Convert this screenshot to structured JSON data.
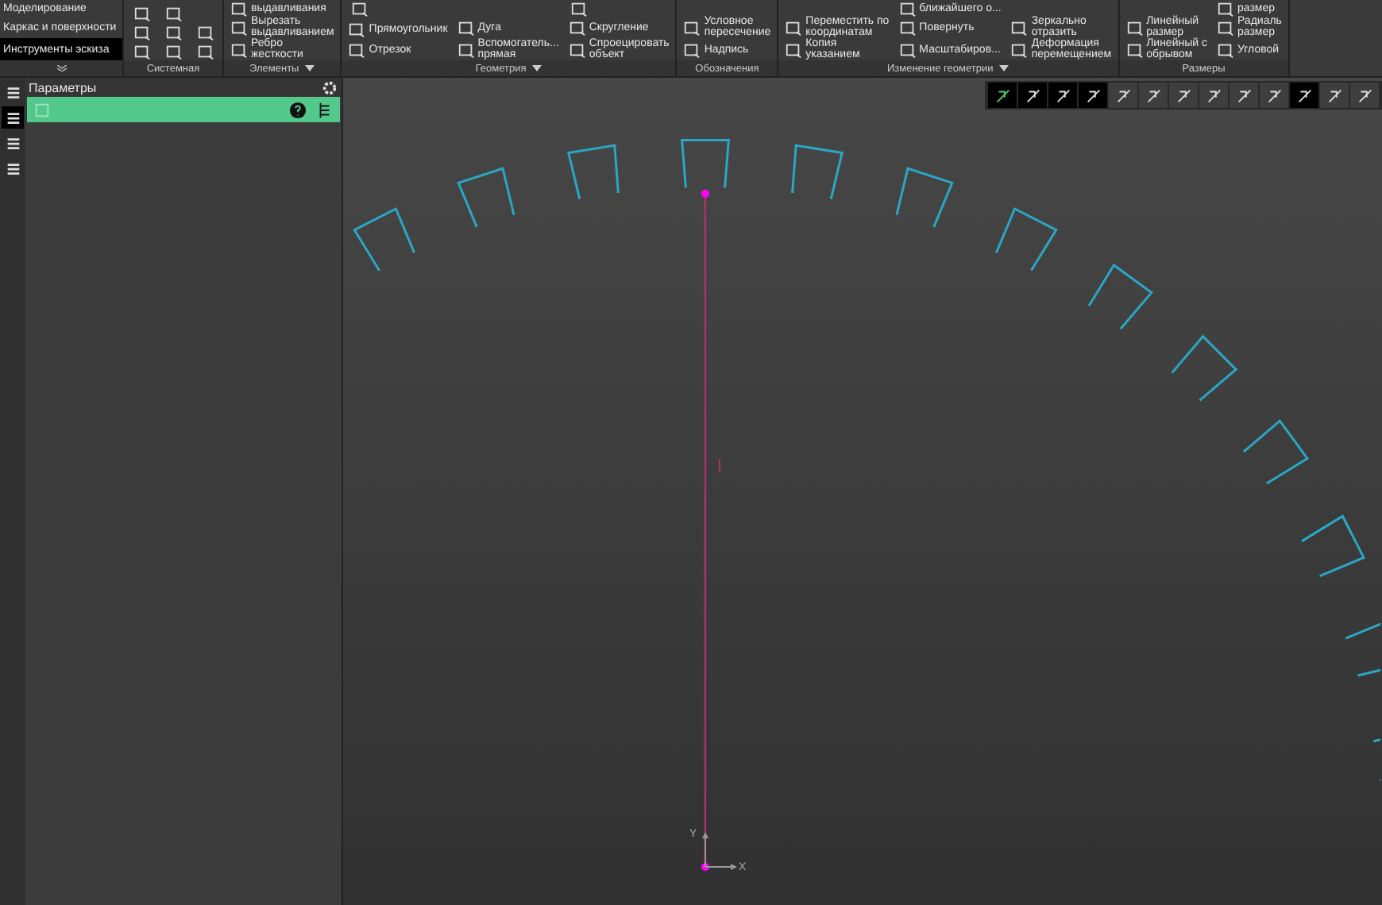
{
  "modes": {
    "items": [
      {
        "label": "Моделирование",
        "selected": false
      },
      {
        "label": "Каркас и поверхности",
        "selected": false
      },
      {
        "label": "Инструменты эскиза",
        "selected": true
      }
    ]
  },
  "ribbon": [
    {
      "label": "Системная",
      "has_menu": false,
      "columns": [
        [
          {
            "kind": "button"
          },
          {
            "kind": "button"
          },
          {
            "kind": "button"
          }
        ],
        [
          {
            "kind": "button"
          },
          {
            "kind": "button"
          },
          {
            "kind": "button"
          }
        ],
        [
          {
            "kind": "button"
          },
          {
            "kind": "button"
          }
        ]
      ]
    },
    {
      "label": "Элементы",
      "has_menu": true,
      "columns": [
        [
          {
            "kind": "tool",
            "label": "выдавливания"
          },
          {
            "kind": "tool",
            "label": "Вырезать выдавливанием"
          },
          {
            "kind": "tool",
            "label": "Ребро жесткости"
          }
        ]
      ]
    },
    {
      "label": "Геометрия",
      "has_menu": true,
      "columns": [
        [
          {
            "kind": "button"
          },
          {
            "kind": "tool",
            "label": "Прямоугольник"
          },
          {
            "kind": "tool",
            "label": "Отрезок"
          }
        ],
        [
          {
            "kind": "tool",
            "label": "Дуга"
          },
          {
            "kind": "tool",
            "label": "Вспомогатель... прямая"
          }
        ],
        [
          {
            "kind": "button"
          },
          {
            "kind": "tool",
            "label": "Скругление"
          },
          {
            "kind": "tool",
            "label": "Спроецировать объект"
          }
        ]
      ]
    },
    {
      "label": "Обозначения",
      "has_menu": false,
      "columns": [
        [
          {
            "kind": "tool",
            "label": "Условное пересечение"
          },
          {
            "kind": "tool",
            "label": "Надпись"
          }
        ]
      ]
    },
    {
      "label": "Изменение геометрии",
      "has_menu": true,
      "columns": [
        [
          {
            "kind": "tool",
            "label": "Переместить по координатам"
          },
          {
            "kind": "tool",
            "label": "Копия указанием"
          }
        ],
        [
          {
            "kind": "tool",
            "label": "ближайшего о..."
          },
          {
            "kind": "tool",
            "label": "Повернуть"
          },
          {
            "kind": "tool",
            "label": "Масштабиров..."
          }
        ],
        [
          {
            "kind": "tool",
            "label": "Зеркально отразить"
          },
          {
            "kind": "tool",
            "label": "Деформация перемещением"
          }
        ]
      ]
    },
    {
      "label": "Размеры",
      "has_menu": false,
      "columns": [
        [
          {
            "kind": "tool",
            "label": "Линейный размер"
          },
          {
            "kind": "tool",
            "label": "Линейный с обрывом"
          }
        ],
        [
          {
            "kind": "tool",
            "label": "размер"
          },
          {
            "kind": "tool",
            "label": "Радиаль размер"
          },
          {
            "kind": "tool",
            "label": "Угловой"
          }
        ]
      ]
    }
  ],
  "side_tabs": [
    {
      "selected": false
    },
    {
      "selected": true
    },
    {
      "selected": false
    },
    {
      "selected": false
    }
  ],
  "panel": {
    "title": "Параметры"
  },
  "view_toolbar": [
    {
      "selected": true
    },
    {
      "selected": true
    },
    {
      "selected": true
    },
    {
      "selected": true
    },
    {
      "selected": false
    },
    {
      "selected": false
    },
    {
      "selected": false
    },
    {
      "selected": false
    },
    {
      "selected": false
    },
    {
      "selected": false
    },
    {
      "selected": true
    },
    {
      "selected": false
    },
    {
      "selected": false
    }
  ],
  "canvas": {
    "axis_x": "X",
    "axis_y": "Y"
  }
}
